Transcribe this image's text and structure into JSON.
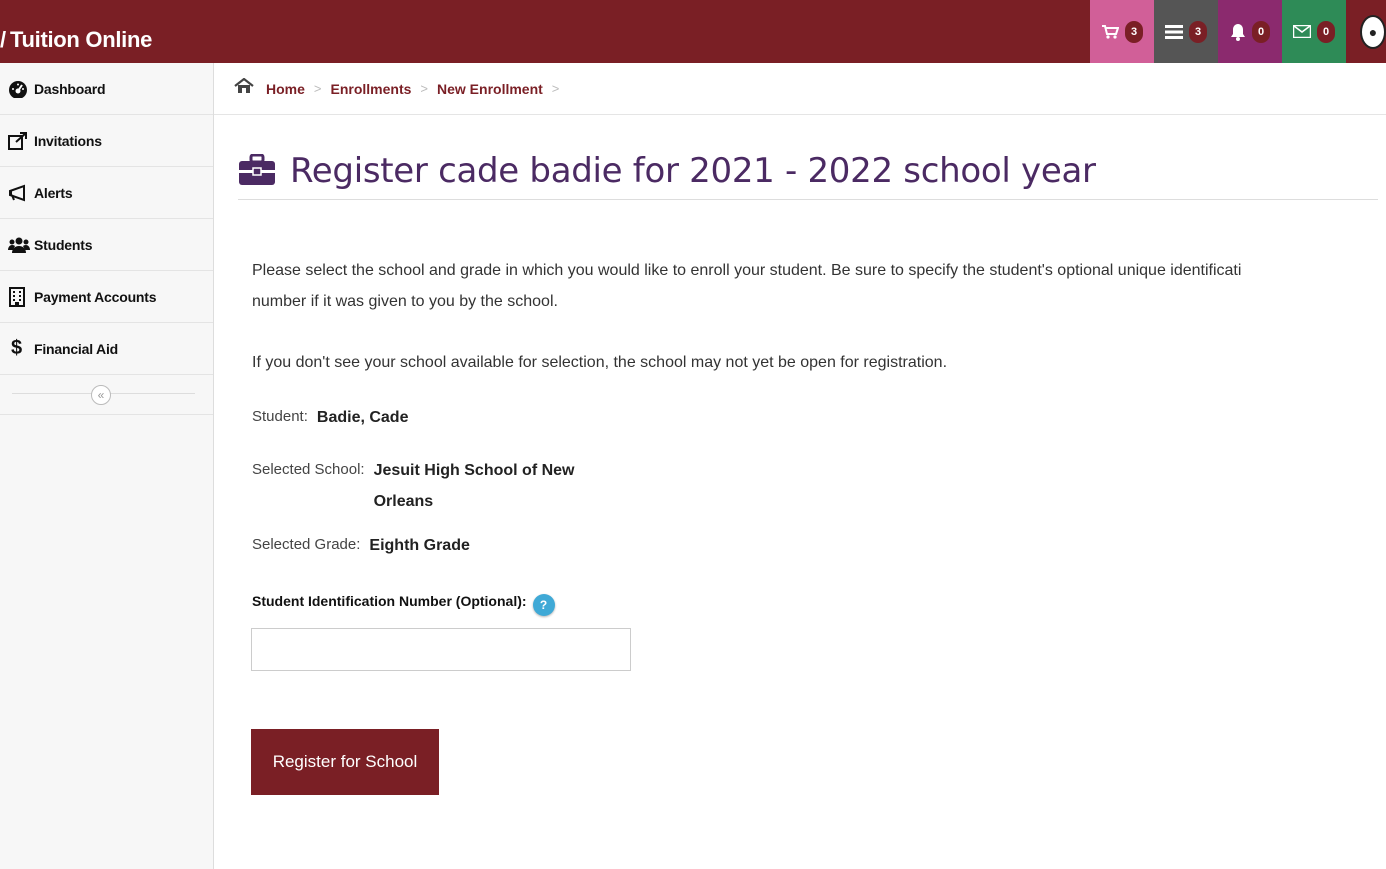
{
  "brand": {
    "title": "Tuition Online"
  },
  "topnav": {
    "cart_count": "3",
    "list_count": "3",
    "alerts_count": "0",
    "messages_count": "0"
  },
  "sidebar": {
    "items": [
      {
        "label": "Dashboard",
        "icon": "dashboard-icon"
      },
      {
        "label": "Invitations",
        "icon": "external-link-icon"
      },
      {
        "label": "Alerts",
        "icon": "megaphone-icon"
      },
      {
        "label": "Students",
        "icon": "users-icon"
      },
      {
        "label": "Payment Accounts",
        "icon": "building-icon"
      },
      {
        "label": "Financial Aid",
        "icon": "dollar-icon"
      }
    ],
    "collapse_glyph": "«"
  },
  "breadcrumb": [
    "Home",
    "Enrollments",
    "New Enrollment"
  ],
  "page": {
    "title": "Register cade badie for 2021 - 2022 school year",
    "intro": "Please select the school and grade in which you would like to enroll your student. Be sure to specify the student's optional unique identification number if it was given to you by the school.",
    "intro_line1": "Please select the school and grade in which you would like to enroll your student. Be sure to specify the student's optional unique identificati",
    "intro_line2": "number if it was given to you by the school.",
    "note": "If you don't see your school available for selection, the school may not yet be open for registration."
  },
  "enrollment": {
    "student_label": "Student:",
    "student_value": "Badie, Cade",
    "school_label": "Selected School:",
    "school_value": "Jesuit High School of New Orleans",
    "grade_label": "Selected Grade:",
    "grade_value": "Eighth Grade",
    "sid_label": "Student Identification Number (Optional):",
    "sid_value": "",
    "register_label": "Register for School"
  },
  "colors": {
    "brand": "#7a1f25",
    "title": "#4b2a63",
    "cart": "#d15f98",
    "list": "#555555",
    "bell": "#8b2a6e",
    "mail": "#2e8b57",
    "help": "#3fa9d6"
  }
}
